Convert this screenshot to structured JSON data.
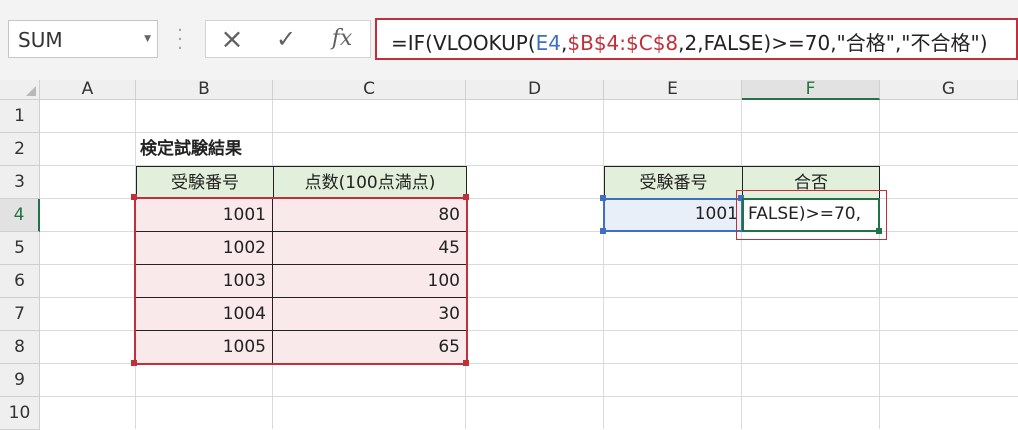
{
  "formula_bar": {
    "name_box": "SUM",
    "cancel_icon": "×",
    "enter_icon": "✓",
    "fx_label": "fx",
    "formula": {
      "prefix": "=IF(VLOOKUP(",
      "ref_e4": "E4",
      "comma1": ",",
      "ref_range": "$B$4:$C$8",
      "rest": ",2,FALSE)>=70,\"合格\",\"不合格\")"
    }
  },
  "columns": [
    "A",
    "B",
    "C",
    "D",
    "E",
    "F",
    "G"
  ],
  "rows": [
    "1",
    "2",
    "3",
    "4",
    "5",
    "6",
    "7",
    "8",
    "9",
    "10"
  ],
  "sheet": {
    "title": "検定試験結果",
    "table_headers": [
      "受験番号",
      "点数(100点満点)"
    ],
    "table_rows": [
      {
        "id": "1001",
        "score": "80"
      },
      {
        "id": "1002",
        "score": "45"
      },
      {
        "id": "1003",
        "score": "100"
      },
      {
        "id": "1004",
        "score": "30"
      },
      {
        "id": "1005",
        "score": "65"
      }
    ],
    "lookup_headers": [
      "受験番号",
      "合否"
    ],
    "lookup_id": "1001",
    "editing_text": "FALSE)>=70,"
  },
  "colors": {
    "accent_green": "#217346",
    "ref_blue": "#3f6fc2",
    "ref_red": "#c0303b",
    "header_fill": "#e2efda",
    "range_fill": "#f9e9ea"
  }
}
